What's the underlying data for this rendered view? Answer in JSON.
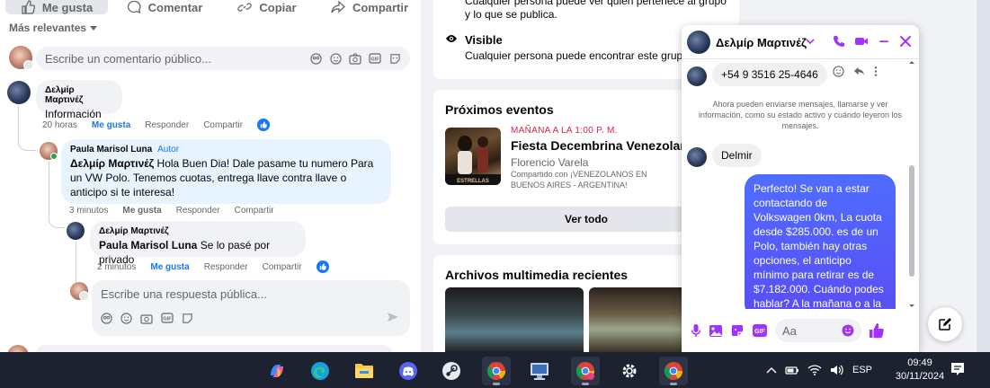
{
  "feed": {
    "actions": {
      "like": "Me gusta",
      "comment": "Comentar",
      "copy": "Copiar",
      "share": "Compartir"
    },
    "sort_label": "Más relevantes",
    "comment_placeholder": "Escribe un comentario público...",
    "comments": [
      {
        "author": "Δελμίρ Μαρτινέζ",
        "text": "Información",
        "time": "20 horas",
        "like": "Me gusta",
        "reply": "Responder",
        "share": "Compartir"
      },
      {
        "author": "Paula Marisol Luna",
        "tag": "Autor",
        "mention": "Δελμίρ Μαρτινέζ",
        "text": " Hola Buen Dia! Dale pasame tu numero Para un VW Polo. Tenemos cuotas, entrega llave contra llave o anticipo si te interesa!",
        "time": "3 minutos",
        "like": "Me gusta",
        "reply": "Responder",
        "share": "Compartir"
      },
      {
        "author": "Δελμίρ Μαρτινέζ",
        "mention": "Paula Marisol Luna",
        "text": " Se lo pasé por privado",
        "time": "2 minutos",
        "like": "Me gusta",
        "reply": "Responder",
        "share": "Compartir"
      }
    ],
    "reply_placeholder": "Escribe una respuesta pública..."
  },
  "group": {
    "privacy_line": "Cualquier persona puede ver quién pertenece al grupo y lo que se publica.",
    "visible_title": "Visible",
    "visible_desc": "Cualquier persona puede encontrar este grupo.",
    "events_title": "Próximos eventos",
    "event": {
      "when": "MAÑANA A LA 1:00 P. M.",
      "name": "Fiesta Decembrina Venezolana",
      "place": "Florencio Varela",
      "shared": "Compartido con ¡VENEZOLANOS EN BUENOS AIRES - ARGENTINA!",
      "img_caption": "ESTRELLAS"
    },
    "see_all": "Ver todo",
    "media_title": "Archivos multimedia recientes"
  },
  "chat": {
    "name": "Δελμίρ Μαρτινέζ",
    "phone_msg": "+54 9 3516 25-4646",
    "system_note": "Ahora pueden enviarse mensajes, llamarse y ver información, como su estado activo y cuándo leyeron los mensajes.",
    "msg_in": "Delmir",
    "msg_out": "Perfecto!  Se van a estar contactando de Volkswagen 0km, La cuota desde $285.000. es de un Polo, también hay otras opciones, el anticipo mínimo para retirar es de $7.182.000. Cuándo podes hablar? A la mañana o a la",
    "input_placeholder": "Aa"
  },
  "taskbar": {
    "language": "ESP",
    "time": "09:49",
    "date": "30/11/2024"
  },
  "colors": {
    "accent": "#1877f2",
    "messenger": "#a033ff",
    "event_date": "#e41e3f"
  }
}
